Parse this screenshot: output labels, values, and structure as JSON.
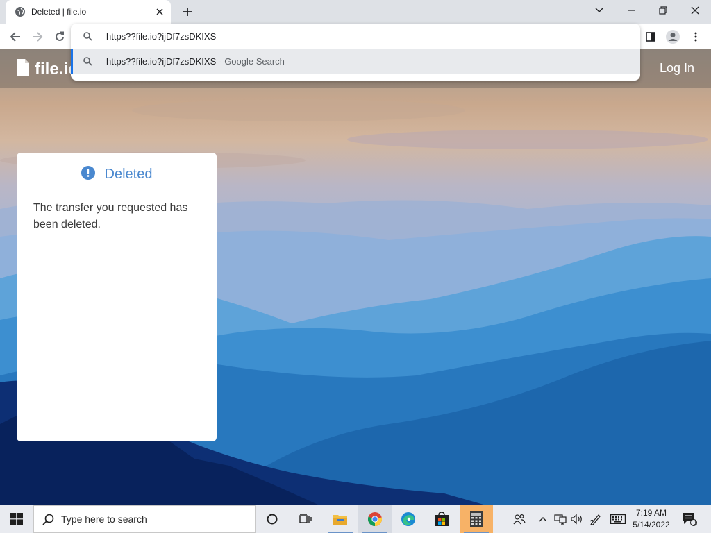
{
  "browser": {
    "tab_title": "Deleted | file.io",
    "address": "https??file.io?ijDf7zsDKIXS",
    "address_display": "https??file.io?ijDf7zsDKIXS"
  },
  "omnibox": {
    "input_value": "https??file.io?ijDf7zsDKIXS",
    "suggestion_text": "https??file.io?ijDf7zsDKIXS",
    "suggestion_sub": "- Google Search"
  },
  "site": {
    "logo_text": "file.io",
    "login_label": "Log In"
  },
  "card": {
    "title": "Deleted",
    "message": "The transfer you requested has been deleted."
  },
  "taskbar": {
    "search_placeholder": "Type here to search",
    "time": "7:19 AM",
    "date": "5/14/2022",
    "notification_count": "1"
  },
  "colors": {
    "accent": "#4a88cf",
    "highlight": "#1a73e8"
  }
}
